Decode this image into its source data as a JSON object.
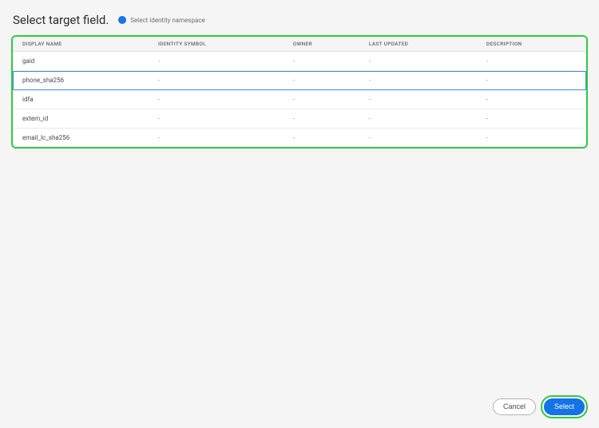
{
  "header": {
    "title": "Select target field.",
    "radioLabel": "Select identity namespace"
  },
  "table": {
    "columns": [
      "DISPLAY NAME",
      "IDENTITY SYMBOL",
      "OWNER",
      "LAST UPDATED",
      "DESCRIPTION"
    ],
    "rows": [
      {
        "displayName": "gaid",
        "identitySymbol": "-",
        "owner": "-",
        "lastUpdated": "-",
        "description": "-",
        "selected": false
      },
      {
        "displayName": "phone_sha256",
        "identitySymbol": "-",
        "owner": "-",
        "lastUpdated": "-",
        "description": "-",
        "selected": true
      },
      {
        "displayName": "idfa",
        "identitySymbol": "-",
        "owner": "-",
        "lastUpdated": "-",
        "description": "-",
        "selected": false
      },
      {
        "displayName": "extern_id",
        "identitySymbol": "-",
        "owner": "-",
        "lastUpdated": "-",
        "description": "-",
        "selected": false
      },
      {
        "displayName": "email_lc_sha256",
        "identitySymbol": "-",
        "owner": "-",
        "lastUpdated": "-",
        "description": "-",
        "selected": false
      }
    ]
  },
  "footer": {
    "cancelLabel": "Cancel",
    "selectLabel": "Select"
  }
}
